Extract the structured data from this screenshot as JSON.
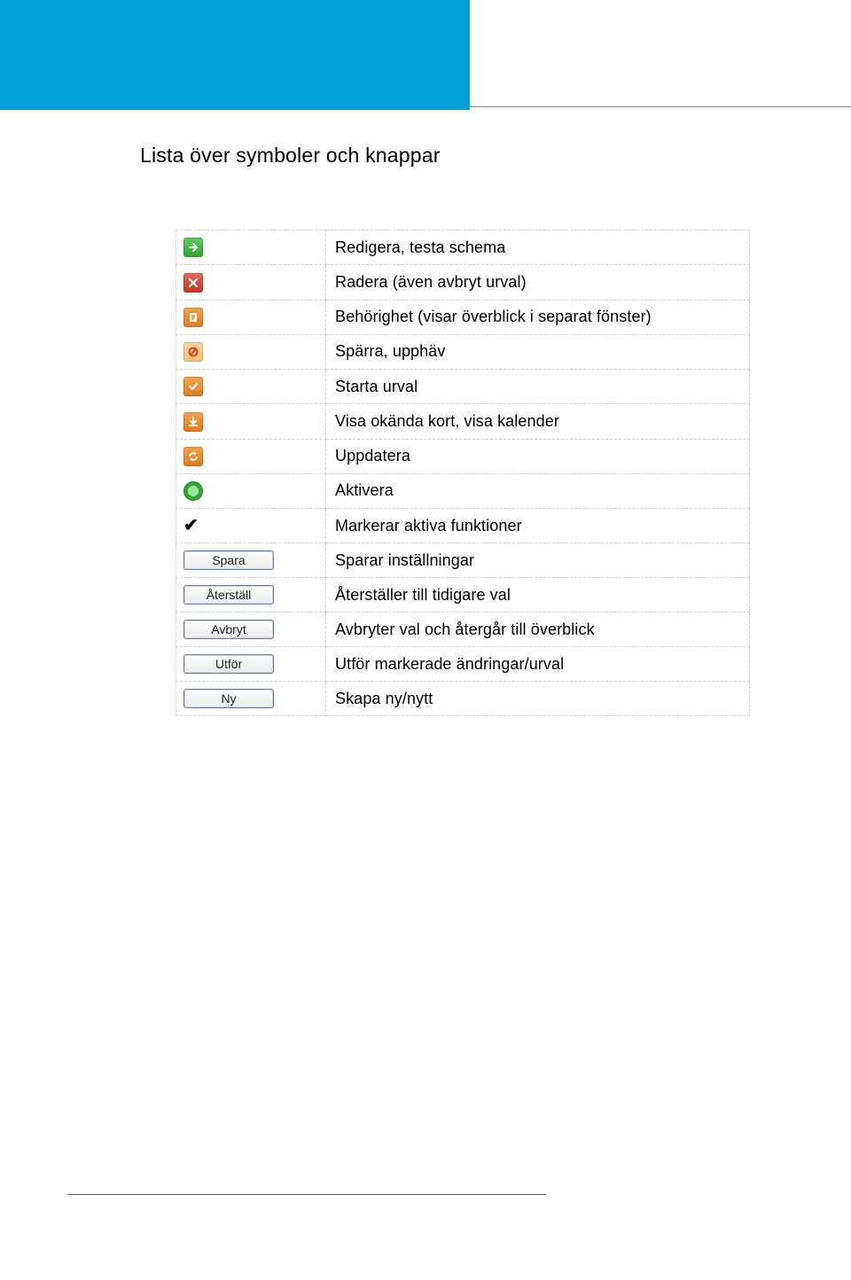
{
  "heading": "Lista över symboler och knappar",
  "rows": [
    {
      "kind": "icon",
      "icon": "arrow-right-icon",
      "desc": "Redigera, testa schema"
    },
    {
      "kind": "icon",
      "icon": "delete-x-icon",
      "desc": "Radera (även avbryt urval)"
    },
    {
      "kind": "icon",
      "icon": "document-icon",
      "desc": "Behörighet (visar överblick i separat fönster)"
    },
    {
      "kind": "icon",
      "icon": "block-icon",
      "desc": "Spärra, upphäv"
    },
    {
      "kind": "icon",
      "icon": "check-icon",
      "desc": "Starta urval"
    },
    {
      "kind": "icon",
      "icon": "download-icon",
      "desc": "Visa okända kort, visa kalender"
    },
    {
      "kind": "icon",
      "icon": "refresh-icon",
      "desc": "Uppdatera"
    },
    {
      "kind": "icon",
      "icon": "activate-ring-icon",
      "desc": "Aktivera"
    },
    {
      "kind": "glyph",
      "glyph": "✔",
      "desc": "Markerar aktiva funktioner"
    },
    {
      "kind": "button",
      "label": "Spara",
      "desc": "Sparar inställningar"
    },
    {
      "kind": "button",
      "label": "Återställ",
      "desc": "Återställer till tidigare val"
    },
    {
      "kind": "button",
      "label": "Avbryt",
      "desc": "Avbryter val och återgår till överblick"
    },
    {
      "kind": "button",
      "label": "Utför",
      "desc": "Utför markerade ändringar/urval"
    },
    {
      "kind": "button",
      "label": "Ny",
      "desc": "Skapa ny/nytt"
    }
  ]
}
